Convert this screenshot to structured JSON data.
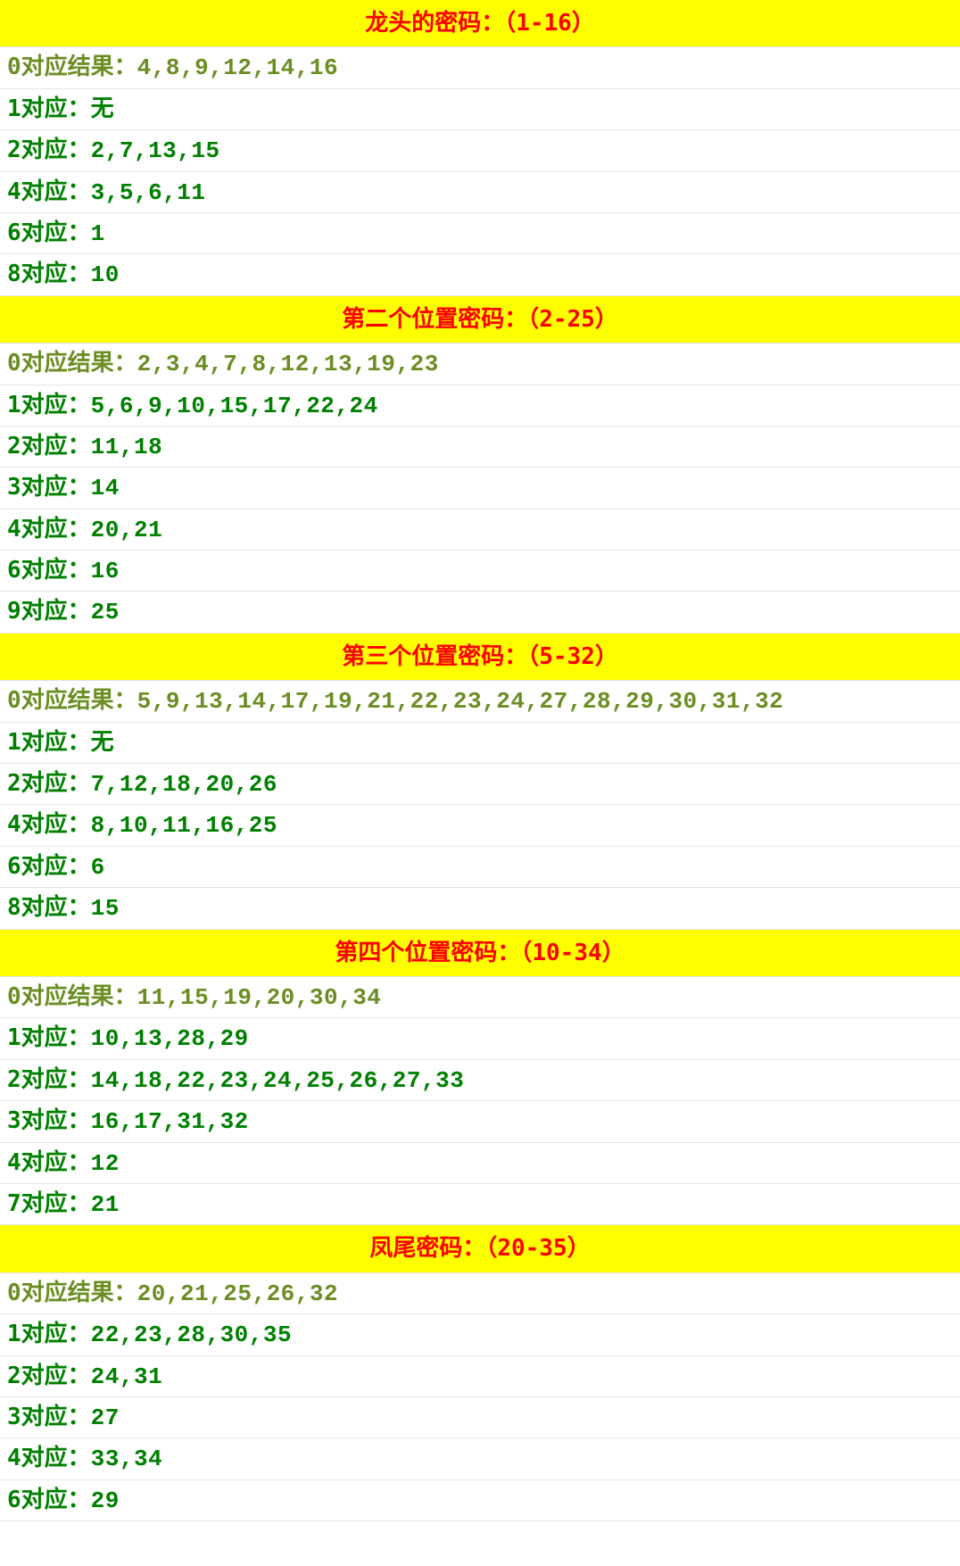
{
  "sections": [
    {
      "title": "龙头的密码：（1-16）",
      "rows": [
        {
          "label": "0对应结果：",
          "value": "4,8,9,12,14,16"
        },
        {
          "label": "1对应：",
          "value": "无"
        },
        {
          "label": "2对应：",
          "value": "2,7,13,15"
        },
        {
          "label": "4对应：",
          "value": "3,5,6,11"
        },
        {
          "label": "6对应：",
          "value": "1"
        },
        {
          "label": "8对应：",
          "value": "10"
        }
      ]
    },
    {
      "title": "第二个位置密码：（2-25）",
      "rows": [
        {
          "label": "0对应结果：",
          "value": "2,3,4,7,8,12,13,19,23"
        },
        {
          "label": "1对应：",
          "value": "5,6,9,10,15,17,22,24"
        },
        {
          "label": "2对应：",
          "value": "11,18"
        },
        {
          "label": "3对应：",
          "value": "14"
        },
        {
          "label": "4对应：",
          "value": "20,21"
        },
        {
          "label": "6对应：",
          "value": "16"
        },
        {
          "label": "9对应：",
          "value": "25"
        }
      ]
    },
    {
      "title": "第三个位置密码：（5-32）",
      "rows": [
        {
          "label": "0对应结果：",
          "value": "5,9,13,14,17,19,21,22,23,24,27,28,29,30,31,32"
        },
        {
          "label": "1对应：",
          "value": "无"
        },
        {
          "label": "2对应：",
          "value": "7,12,18,20,26"
        },
        {
          "label": "4对应：",
          "value": "8,10,11,16,25"
        },
        {
          "label": "6对应：",
          "value": "6"
        },
        {
          "label": "8对应：",
          "value": "15"
        }
      ]
    },
    {
      "title": "第四个位置密码：（10-34）",
      "rows": [
        {
          "label": "0对应结果：",
          "value": "11,15,19,20,30,34"
        },
        {
          "label": "1对应：",
          "value": "10,13,28,29"
        },
        {
          "label": "2对应：",
          "value": "14,18,22,23,24,25,26,27,33"
        },
        {
          "label": "3对应：",
          "value": "16,17,31,32"
        },
        {
          "label": "4对应：",
          "value": "12"
        },
        {
          "label": "7对应：",
          "value": "21"
        }
      ]
    },
    {
      "title": "凤尾密码：（20-35）",
      "rows": [
        {
          "label": "0对应结果：",
          "value": "20,21,25,26,32"
        },
        {
          "label": "1对应：",
          "value": "22,23,28,30,35"
        },
        {
          "label": "2对应：",
          "value": "24,31"
        },
        {
          "label": "3对应：",
          "value": "27"
        },
        {
          "label": "4对应：",
          "value": "33,34"
        },
        {
          "label": "6对应：",
          "value": "29"
        }
      ]
    }
  ]
}
